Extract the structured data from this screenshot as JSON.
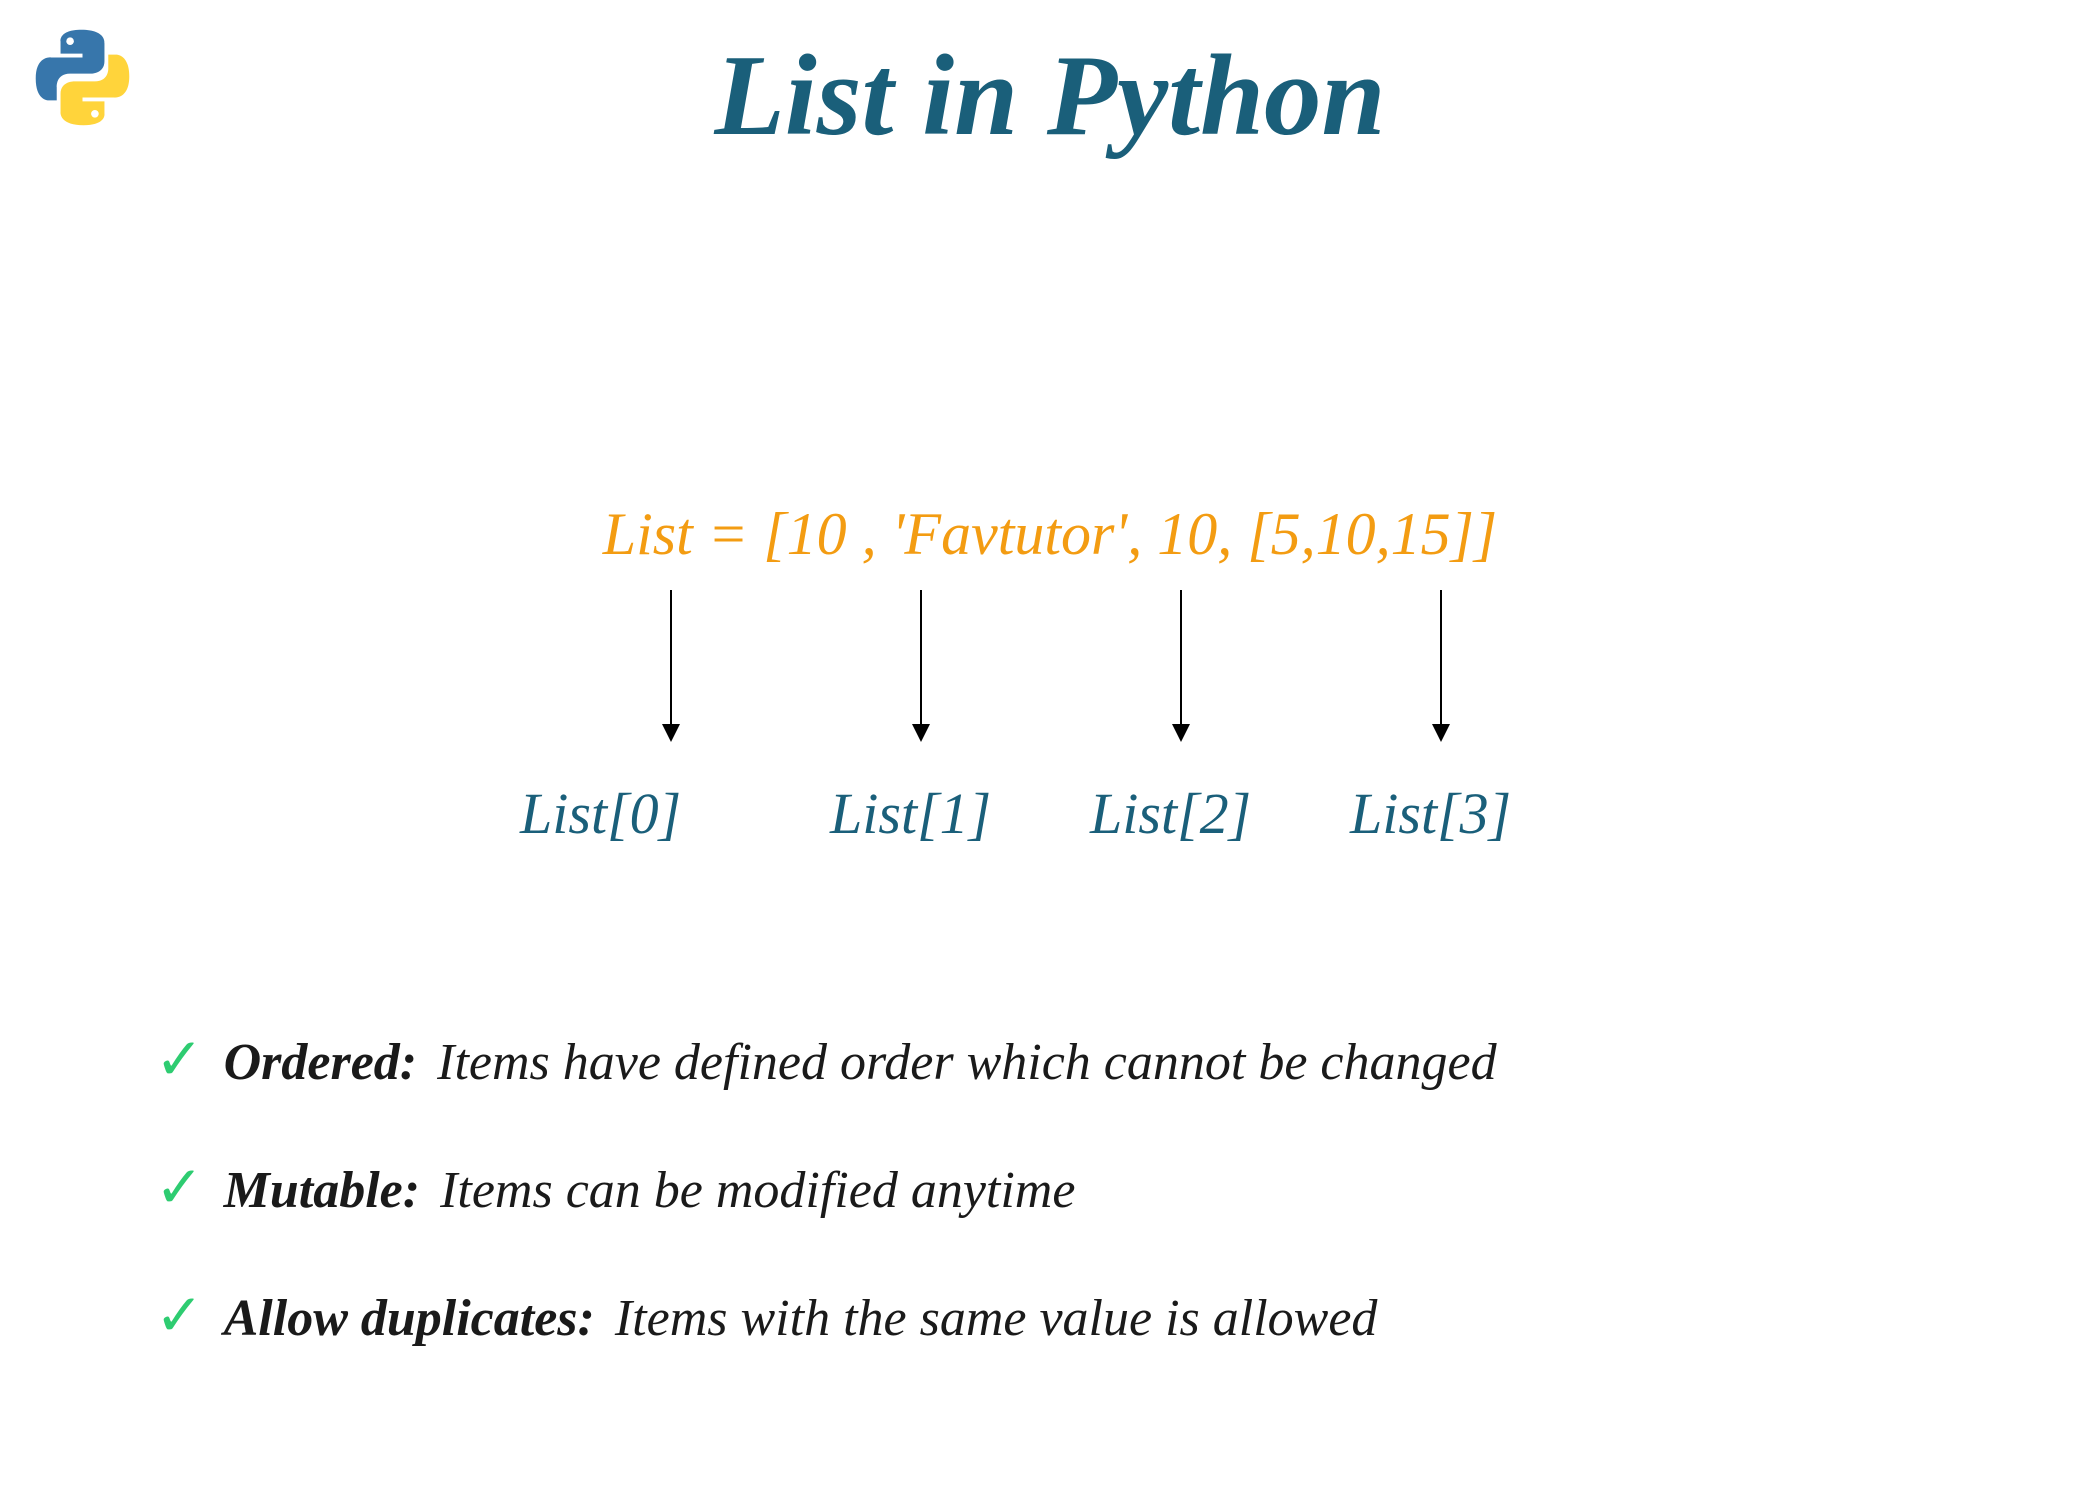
{
  "title": "List in Python",
  "list_definition": "List = [10 , 'Favtutor', 10, [5,10,15]]",
  "indices": {
    "idx0": "List[0]",
    "idx1": "List[1]",
    "idx2": "List[2]",
    "idx3": "List[3]"
  },
  "properties": [
    {
      "name": "Ordered:",
      "desc": "Items have defined order which cannot be changed"
    },
    {
      "name": "Mutable:",
      "desc": "Items can be modified anytime"
    },
    {
      "name": "Allow duplicates:",
      "desc": "Items with the same value is  allowed"
    }
  ],
  "colors": {
    "teal": "#1a5f7a",
    "orange": "#f39c12",
    "green": "#2ecc71",
    "python_blue": "#3776ab",
    "python_yellow": "#ffd43b"
  }
}
